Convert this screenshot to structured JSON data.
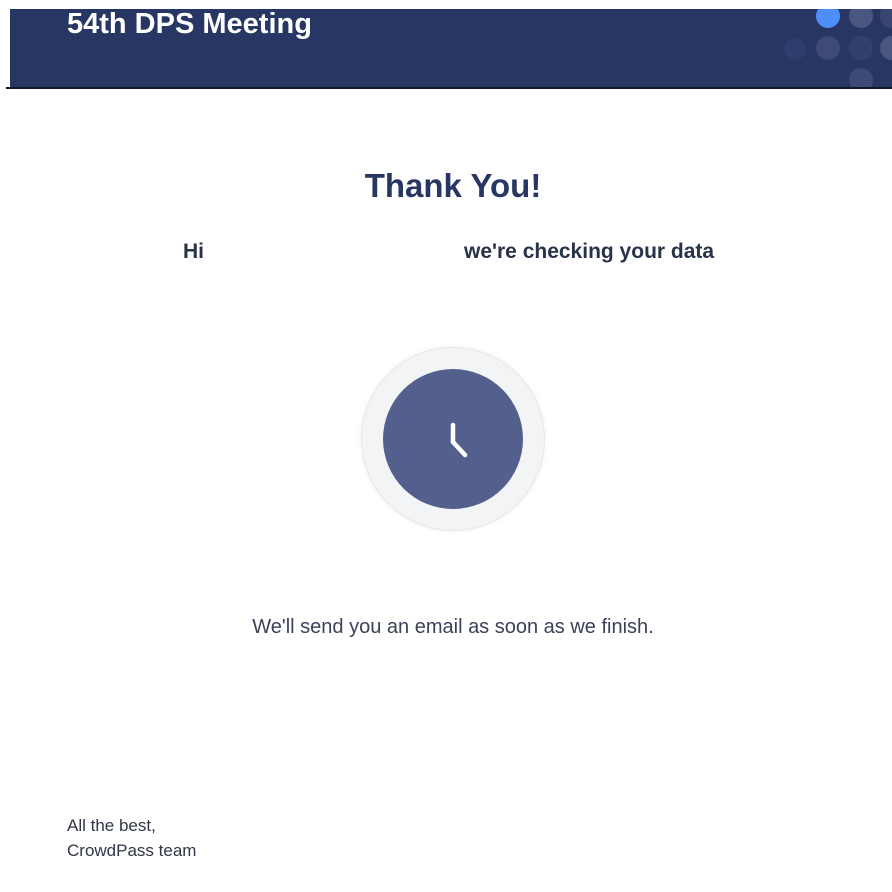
{
  "header": {
    "title": "54th DPS Meeting",
    "background_color": "#283664"
  },
  "main": {
    "heading": "Thank You!",
    "greeting_prefix": "Hi",
    "greeting_suffix": "we're checking your data",
    "status_icon": "clock-icon",
    "notice": "We'll send you an email as soon as we finish."
  },
  "footer": {
    "line1": "All the best,",
    "line2": "CrowdPass team"
  },
  "colors": {
    "primary": "#283664",
    "accent_dot": "#4d8ff8",
    "clock_fill": "#53608e"
  }
}
